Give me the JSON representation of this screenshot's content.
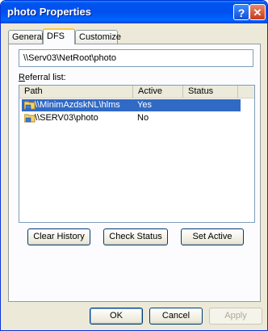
{
  "window": {
    "title": "photo Properties"
  },
  "tabs": [
    {
      "label": "General"
    },
    {
      "label": "DFS"
    },
    {
      "label": "Customize"
    }
  ],
  "dfs": {
    "path_value": "\\\\Serv03\\NetRoot\\photo",
    "referral_label": "Referral list:",
    "columns": [
      "Path",
      "Active",
      "Status"
    ],
    "rows": [
      {
        "path": "\\\\MinimAzdskNL\\hlms",
        "active": "Yes",
        "status": "",
        "selected": true
      },
      {
        "path": "\\\\SERV03\\photo",
        "active": "No",
        "status": "",
        "selected": false
      }
    ],
    "buttons": {
      "clear_history": "Clear History",
      "check_status": "Check Status",
      "set_active": "Set Active"
    }
  },
  "footer": {
    "ok": "OK",
    "cancel": "Cancel",
    "apply": "Apply"
  },
  "icons": {
    "help": "help-icon",
    "close": "close-icon",
    "folder": "share-folder-icon"
  }
}
